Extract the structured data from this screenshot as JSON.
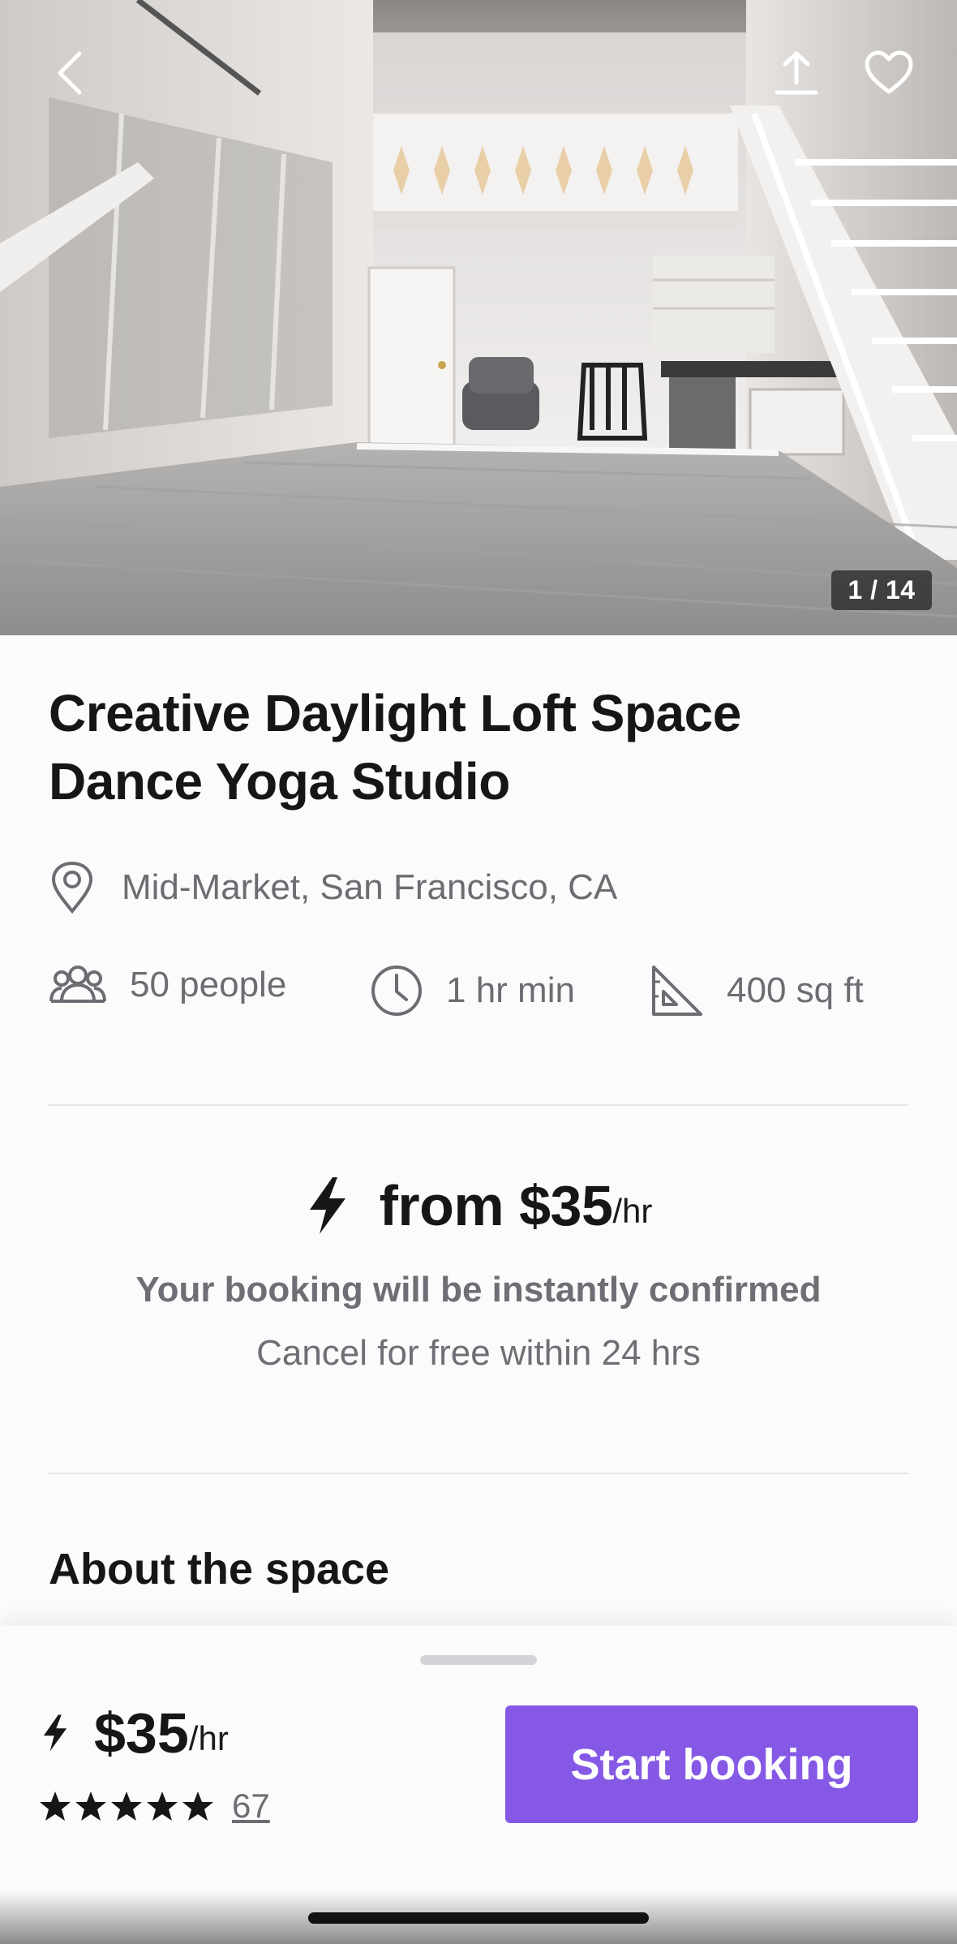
{
  "hero": {
    "photo_counter": "1 / 14",
    "back_icon": "chevron-left-icon",
    "share_icon": "share-upload-icon",
    "favorite_icon": "heart-outline-icon"
  },
  "listing": {
    "title": "Creative Daylight Loft Space Dance Yoga Studio",
    "location": "Mid-Market, San Francisco, CA",
    "capacity": "50 people",
    "min_duration": "1 hr min",
    "area": "400 sq ft"
  },
  "pricing": {
    "from_price": "from $35",
    "unit": "/hr",
    "instant_text": "Your booking will be instantly confirmed",
    "cancel_text": "Cancel for free within 24 hrs"
  },
  "sections": {
    "about_title": "About the space"
  },
  "booking_bar": {
    "price": "$35",
    "unit": "/hr",
    "rating_stars": 5,
    "review_count": "67",
    "cta_label": "Start booking"
  },
  "colors": {
    "accent": "#8559e5",
    "text_primary": "#161616",
    "text_secondary": "#6c6c72"
  }
}
